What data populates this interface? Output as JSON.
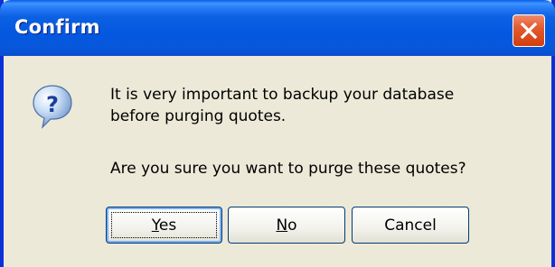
{
  "window": {
    "title": "Confirm"
  },
  "titlebar_buttons": {
    "close_icon": "close-icon"
  },
  "dialog": {
    "icon": "question-icon",
    "message_line1": "It is very important to backup your database",
    "message_line2": "before purging quotes.",
    "question": "Are you sure you want to purge these quotes?"
  },
  "buttons": {
    "yes_label": "Yes",
    "no_label": "No",
    "cancel_label": "Cancel",
    "default": "Yes"
  },
  "colors": {
    "titlebar": "#0458e0",
    "face": "#ece9d8",
    "close": "#e35b2f"
  }
}
